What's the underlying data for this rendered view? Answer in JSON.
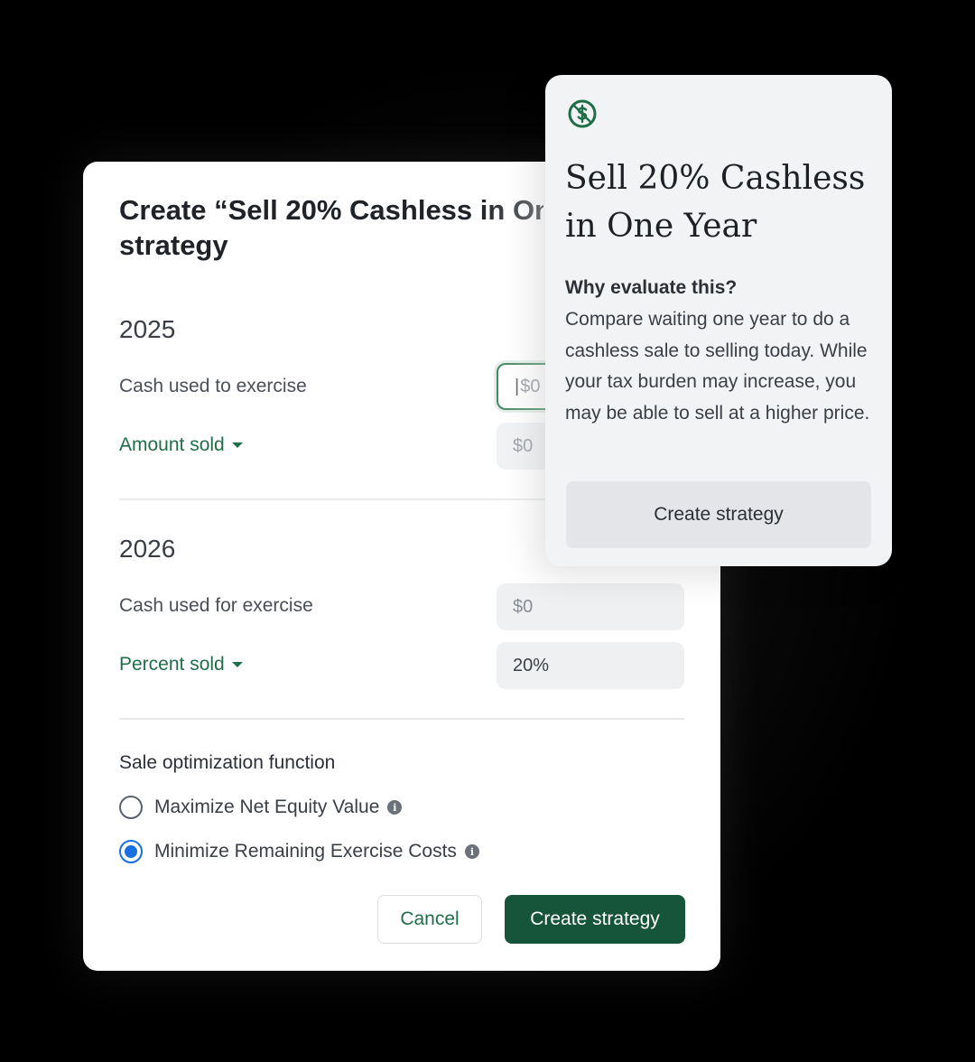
{
  "dialog": {
    "title_line1": "Create “Sell 20% Cashless in One Year”",
    "title_line2": "strategy",
    "year1": {
      "label": "2025",
      "cash_label": "Cash used to exercise",
      "cash_placeholder": "$0",
      "sold_label": "Amount sold",
      "sold_placeholder": "$0"
    },
    "year2": {
      "label": "2026",
      "cash_label": "Cash used for exercise",
      "cash_placeholder": "$0",
      "sold_label": "Percent sold",
      "sold_value": "20%"
    },
    "optimization": {
      "label": "Sale optimization function",
      "options": [
        {
          "label": "Maximize Net Equity Value",
          "checked": false
        },
        {
          "label": "Minimize Remaining Exercise Costs",
          "checked": true
        }
      ]
    },
    "cancel_label": "Cancel",
    "create_label": "Create strategy"
  },
  "card": {
    "icon": "no-dollar-icon",
    "title": "Sell 20% Cashless in One Year",
    "why_heading": "Why evaluate this?",
    "body": "Compare waiting one year to do a cashless sale to selling today. While your tax burden may increase, you may be able to sell at a higher price.",
    "button_label": "Create strategy"
  },
  "colors": {
    "accent_green": "#17553a",
    "link_green": "#1f6e49",
    "radio_blue": "#1a6fe0"
  }
}
